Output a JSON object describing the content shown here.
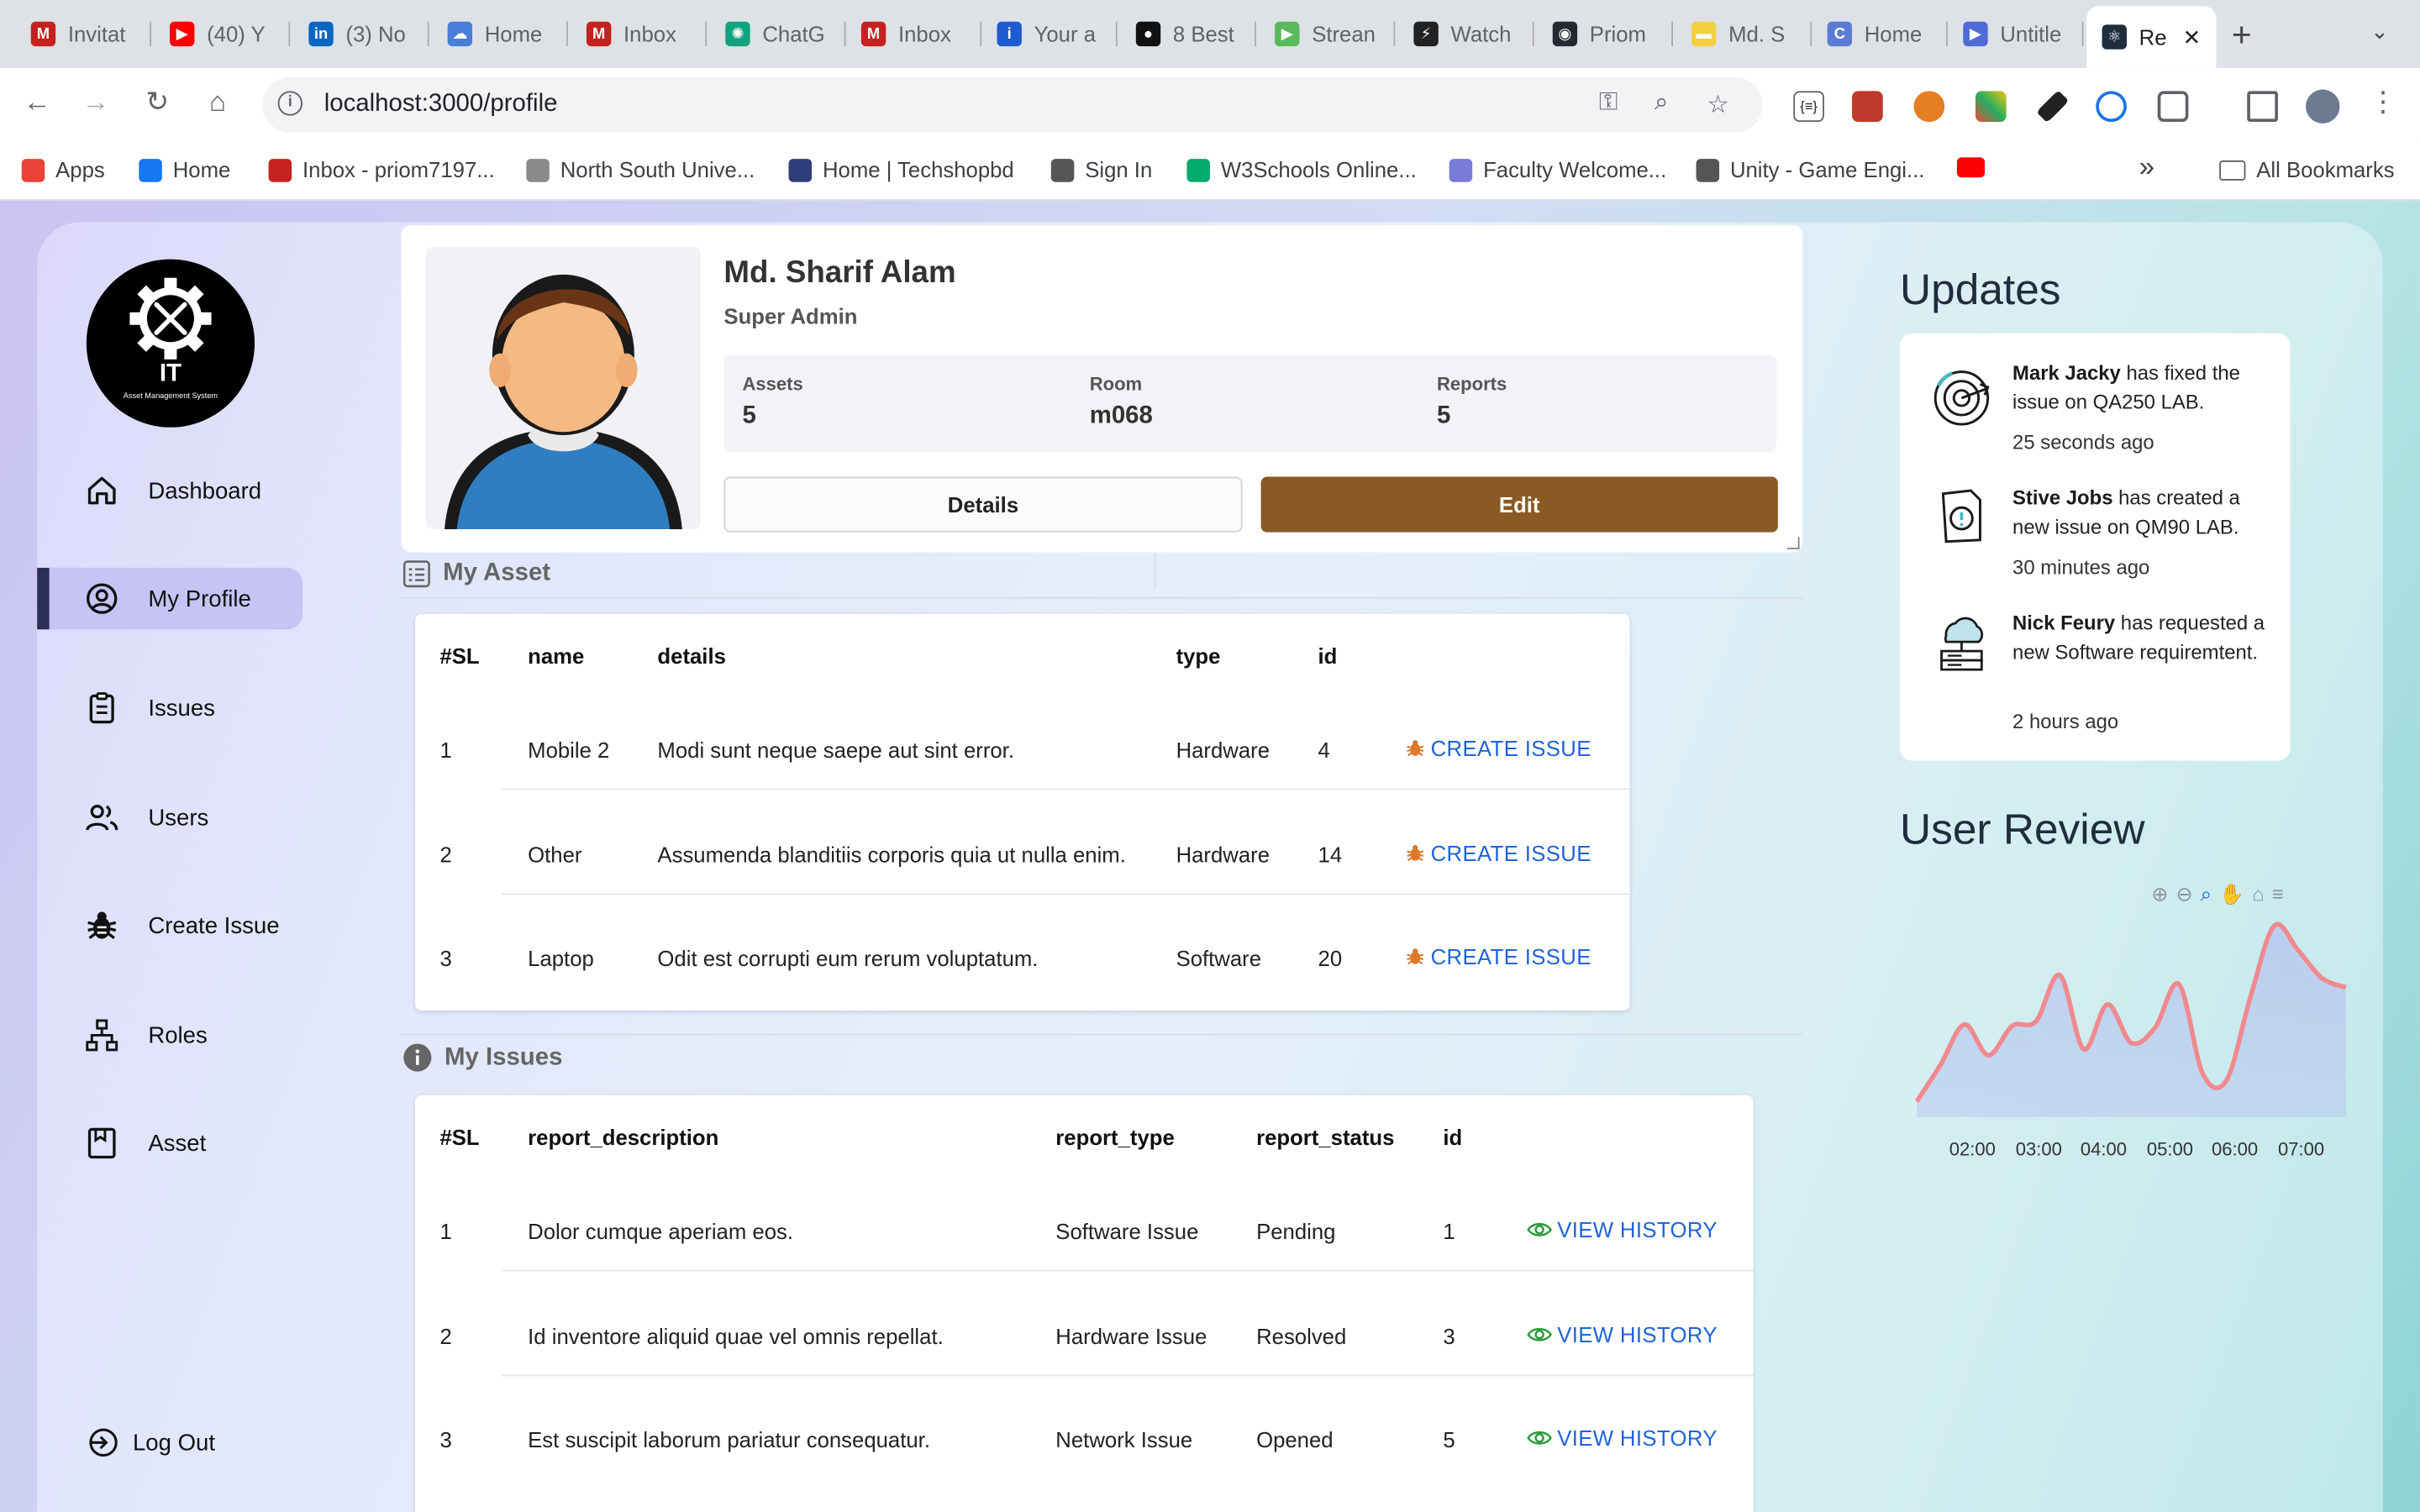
{
  "browser": {
    "tabs": [
      {
        "label": "Invitat",
        "color": "#c5221f",
        "glyph": "M"
      },
      {
        "label": "(40) Y",
        "color": "#ff0000",
        "glyph": "▶"
      },
      {
        "label": "(3) No",
        "color": "#0a66c2",
        "glyph": "in"
      },
      {
        "label": "Home",
        "color": "#4a7fd9",
        "glyph": "☁"
      },
      {
        "label": "Inbox",
        "color": "#c5221f",
        "glyph": "M"
      },
      {
        "label": "ChatG",
        "color": "#10a37f",
        "glyph": "✺"
      },
      {
        "label": "Inbox",
        "color": "#c5221f",
        "glyph": "M"
      },
      {
        "label": "Your a",
        "color": "#1e5bd1",
        "glyph": "i"
      },
      {
        "label": "8 Best",
        "color": "#111111",
        "glyph": "●"
      },
      {
        "label": "Strean",
        "color": "#5cb85c",
        "glyph": "▶"
      },
      {
        "label": "Watch",
        "color": "#222222",
        "glyph": "⚡"
      },
      {
        "label": "Priom",
        "color": "#24292f",
        "glyph": "◉"
      },
      {
        "label": "Md. S",
        "color": "#f4d03f",
        "glyph": "▬"
      },
      {
        "label": "Home",
        "color": "#5b7bd5",
        "glyph": "C"
      },
      {
        "label": "Untitle",
        "color": "#4f6bd8",
        "glyph": "▶"
      },
      {
        "label": "Re",
        "color": "#1f2d3d",
        "glyph": "⚛",
        "active": true
      }
    ],
    "url": "localhost:3000/profile",
    "bookmarks": [
      {
        "label": "Apps",
        "color": "#ea4335"
      },
      {
        "label": "Home",
        "color": "#1877f2"
      },
      {
        "label": "Inbox - priom7197...",
        "color": "#c5221f"
      },
      {
        "label": "North South Unive...",
        "color": "#8a8a8a"
      },
      {
        "label": "Home | Techshopbd",
        "color": "#2d3e7a"
      },
      {
        "label": "Sign In",
        "color": "#555555"
      },
      {
        "label": "W3Schools Online...",
        "color": "#04aa6d"
      },
      {
        "label": "Faculty Welcome...",
        "color": "#7a7ad8"
      },
      {
        "label": "Unity - Game Engi...",
        "color": "#555555"
      },
      {
        "label": "",
        "color": "#ff0000"
      }
    ],
    "all_bookmarks": "All Bookmarks"
  },
  "logo": {
    "title": "IT",
    "subtitle": "Asset Management System"
  },
  "sidebar": {
    "items": [
      {
        "label": "Dashboard",
        "icon": "home-icon"
      },
      {
        "label": "My Profile",
        "icon": "user-circle-icon",
        "active": true
      },
      {
        "label": "Issues",
        "icon": "clipboard-icon"
      },
      {
        "label": "Users",
        "icon": "users-icon"
      },
      {
        "label": "Create Issue",
        "icon": "bug-icon"
      },
      {
        "label": "Roles",
        "icon": "hierarchy-icon"
      },
      {
        "label": "Asset",
        "icon": "asset-icon"
      }
    ],
    "logout": "Log Out"
  },
  "profile": {
    "name": "Md. Sharif Alam",
    "role": "Super Admin",
    "stats": [
      {
        "label": "Assets",
        "value": "5"
      },
      {
        "label": "Room",
        "value": "m068"
      },
      {
        "label": "Reports",
        "value": "5"
      }
    ],
    "details_label": "Details",
    "edit_label": "Edit",
    "accent": "#8a5a25"
  },
  "my_asset": {
    "title": "My Asset",
    "headers": [
      "#SL",
      "name",
      "details",
      "type",
      "id"
    ],
    "action_label": "CREATE ISSUE",
    "rows": [
      {
        "sl": "1",
        "name": "Mobile 2",
        "details": "Modi sunt neque saepe aut sint error.",
        "type": "Hardware",
        "id": "4"
      },
      {
        "sl": "2",
        "name": "Other",
        "details": "Assumenda blanditiis corporis quia ut nulla enim.",
        "type": "Hardware",
        "id": "14"
      },
      {
        "sl": "3",
        "name": "Laptop",
        "details": "Odit est corrupti eum rerum voluptatum.",
        "type": "Software",
        "id": "20"
      }
    ]
  },
  "my_issues": {
    "title": "My Issues",
    "headers": [
      "#SL",
      "report_description",
      "report_type",
      "report_status",
      "id"
    ],
    "action_label": "VIEW HISTORY",
    "rows": [
      {
        "sl": "1",
        "description": "Dolor cumque aperiam eos.",
        "type": "Software Issue",
        "status": "Pending",
        "id": "1"
      },
      {
        "sl": "2",
        "description": "Id inventore aliquid quae vel omnis repellat.",
        "type": "Hardware Issue",
        "status": "Resolved",
        "id": "3"
      },
      {
        "sl": "3",
        "description": "Est suscipit laborum pariatur consequatur.",
        "type": "Network Issue",
        "status": "Opened",
        "id": "5"
      }
    ]
  },
  "updates": {
    "title": "Updates",
    "items": [
      {
        "user": "Mark Jacky",
        "text": " has fixed the issue on QA250 LAB.",
        "time": "25 seconds ago",
        "icon": "target-icon"
      },
      {
        "user": "Stive Jobs",
        "text": " has created a new issue on QM90 LAB.",
        "time": "30 minutes ago",
        "icon": "document-alert-icon"
      },
      {
        "user": "Nick Feury",
        "text": " has requested a new Software requiremtent.",
        "time": "2 hours ago",
        "icon": "cloud-server-icon"
      }
    ]
  },
  "review": {
    "title": "User Review",
    "tools": [
      "zoom-in-icon",
      "zoom-out-icon",
      "magnifier-icon",
      "pan-icon",
      "reset-home-icon",
      "menu-icon"
    ]
  },
  "chart_data": {
    "type": "area",
    "title": "",
    "x": [
      "02:00",
      "03:00",
      "04:00",
      "05:00",
      "06:00",
      "07:00"
    ],
    "series": [
      {
        "values": [
          10,
          34,
          60,
          40,
          59,
          62,
          92,
          44,
          73,
          48,
          58,
          86,
          28,
          24,
          78,
          124,
          108,
          90,
          84
        ]
      }
    ],
    "color": "#f08a8f",
    "fill": "#b9c8ef"
  }
}
